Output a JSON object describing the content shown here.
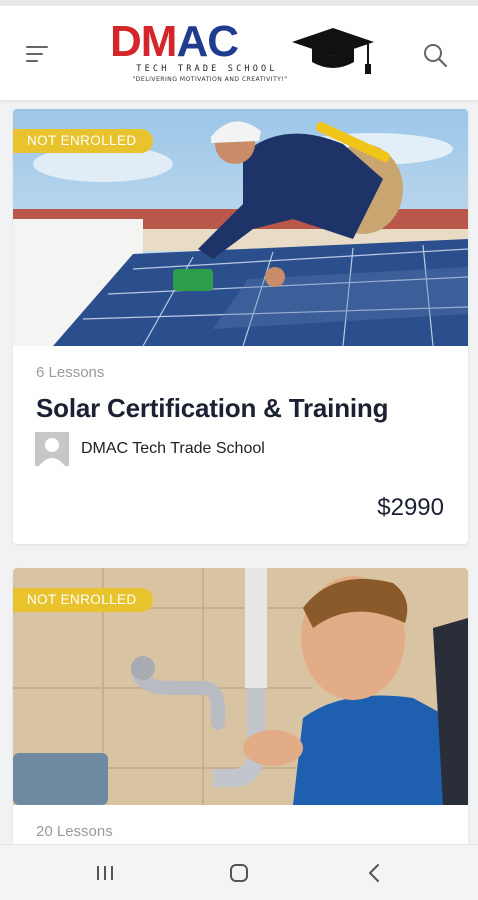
{
  "header": {
    "logo_word_part1": "DM",
    "logo_word_part2": "AC",
    "logo_subtitle": "TECH TRADE SCHOOL",
    "logo_tagline": "\"DELIVERING MOTIVATION AND CREATIVITY!\"",
    "menu_icon": "hamburger-menu-icon",
    "search_icon": "search-icon"
  },
  "courses": [
    {
      "badge": "NOT ENROLLED",
      "lessons": "6 Lessons",
      "title": "Solar Certification & Training",
      "author": "DMAC Tech Trade School",
      "price": "$2990",
      "image": "solar-installer-photo"
    },
    {
      "badge": "NOT ENROLLED",
      "lessons": "20 Lessons",
      "image": "plumber-photo"
    }
  ],
  "system_nav": {
    "recents_icon": "recent-apps-icon",
    "home_icon": "home-icon",
    "back_icon": "back-icon"
  },
  "colors": {
    "brand_red": "#d4262a",
    "brand_blue": "#1f3c8f",
    "badge_yellow": "#e8c32e",
    "title_dark": "#1b2033"
  }
}
